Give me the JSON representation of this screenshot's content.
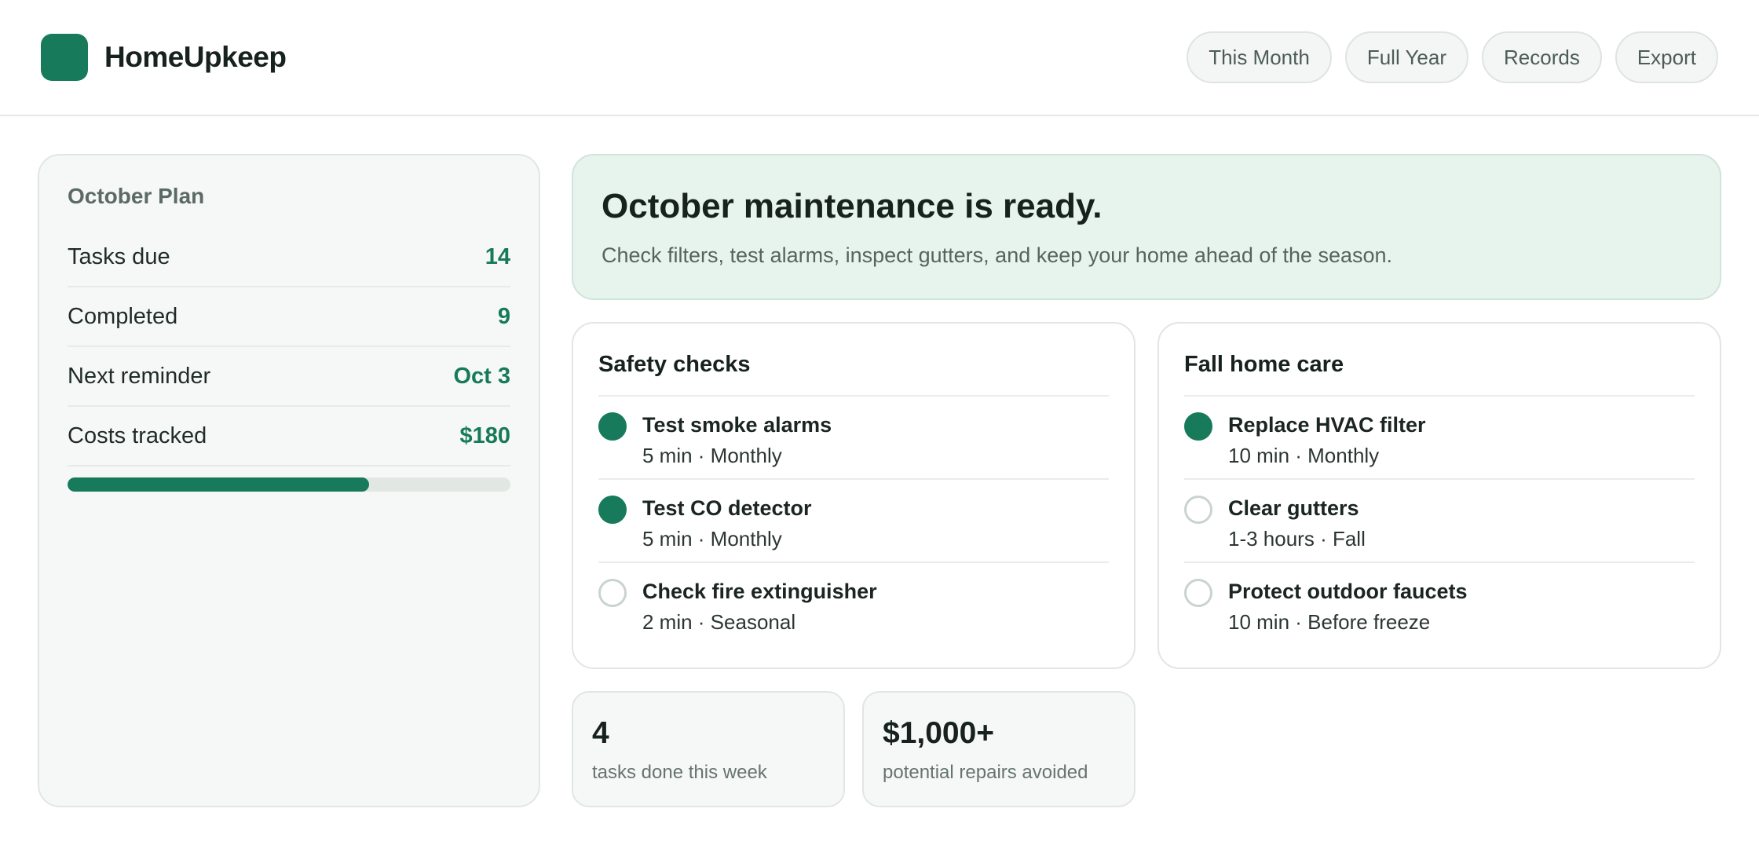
{
  "app": {
    "name": "HomeUpkeep"
  },
  "nav": [
    "This Month",
    "Full Year",
    "Records",
    "Export"
  ],
  "plan": {
    "title": "October Plan",
    "rows": [
      {
        "label": "Tasks due",
        "value": "14"
      },
      {
        "label": "Completed",
        "value": "9"
      },
      {
        "label": "Next reminder",
        "value": "Oct 3"
      },
      {
        "label": "Costs tracked",
        "value": "$180"
      }
    ],
    "progress_fraction": 0.68
  },
  "hero": {
    "title": "October maintenance is ready.",
    "subtitle": "Check filters, test alarms, inspect gutters, and keep your home ahead of the season."
  },
  "cards": [
    {
      "title": "Safety checks",
      "tasks": [
        {
          "name": "Test smoke alarms",
          "meta": "5 min · Monthly",
          "done": true
        },
        {
          "name": "Test CO detector",
          "meta": "5 min · Monthly",
          "done": true
        },
        {
          "name": "Check fire extinguisher",
          "meta": "2 min · Seasonal",
          "done": false
        }
      ]
    },
    {
      "title": "Fall home care",
      "tasks": [
        {
          "name": "Replace HVAC filter",
          "meta": "10 min · Monthly",
          "done": true
        },
        {
          "name": "Clear gutters",
          "meta": "1-3 hours · Fall",
          "done": false
        },
        {
          "name": "Protect outdoor faucets",
          "meta": "10 min · Before freeze",
          "done": false
        }
      ]
    }
  ],
  "stats": [
    {
      "value": "4",
      "label": "tasks done this week"
    },
    {
      "value": "$1,000+",
      "label": "potential repairs avoided"
    }
  ],
  "colors": {
    "accent": "#177a5a",
    "hero_bg": "#e7f4ee",
    "panel_bg": "#f6f8f7"
  }
}
